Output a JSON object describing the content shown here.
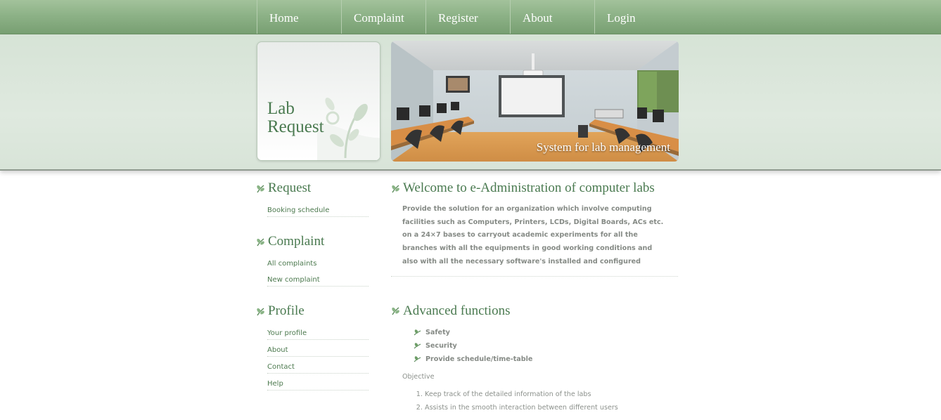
{
  "nav": {
    "items": [
      {
        "label": "Home"
      },
      {
        "label": "Complaint"
      },
      {
        "label": "Register"
      },
      {
        "label": "About"
      },
      {
        "label": "Login"
      }
    ]
  },
  "header": {
    "logo_line1": "Lab",
    "logo_line2": "Request",
    "banner_caption": "System for lab management"
  },
  "sidebar": {
    "sections": [
      {
        "title": "Request",
        "links": [
          "Booking schedule"
        ]
      },
      {
        "title": "Complaint",
        "links": [
          "All complaints",
          "New complaint"
        ]
      },
      {
        "title": "Profile",
        "links": [
          "Your profile",
          "About",
          "Contact",
          "Help"
        ]
      }
    ]
  },
  "main": {
    "welcome_title": "Welcome to e-Administration of computer labs",
    "intro": "Provide the solution for an organization which involve computing facilities such as Computers, Printers, LCDs, Digital Boards, ACs etc. on a 24×7 bases to carryout academic experiments for all the branches with all the equipments in good working conditions and also with all the necessary software's installed and configured",
    "advanced_title": "Advanced functions",
    "features": [
      "Safety",
      "Security",
      "Provide schedule/time-table"
    ],
    "objective_label": "Objective",
    "objectives": [
      "Keep track of the detailed information of the labs",
      "Assists in the smooth interaction between different users"
    ]
  },
  "colors": {
    "nav_green": "#8db287",
    "heading_green": "#4a7a50",
    "band": "#dfe9df"
  }
}
